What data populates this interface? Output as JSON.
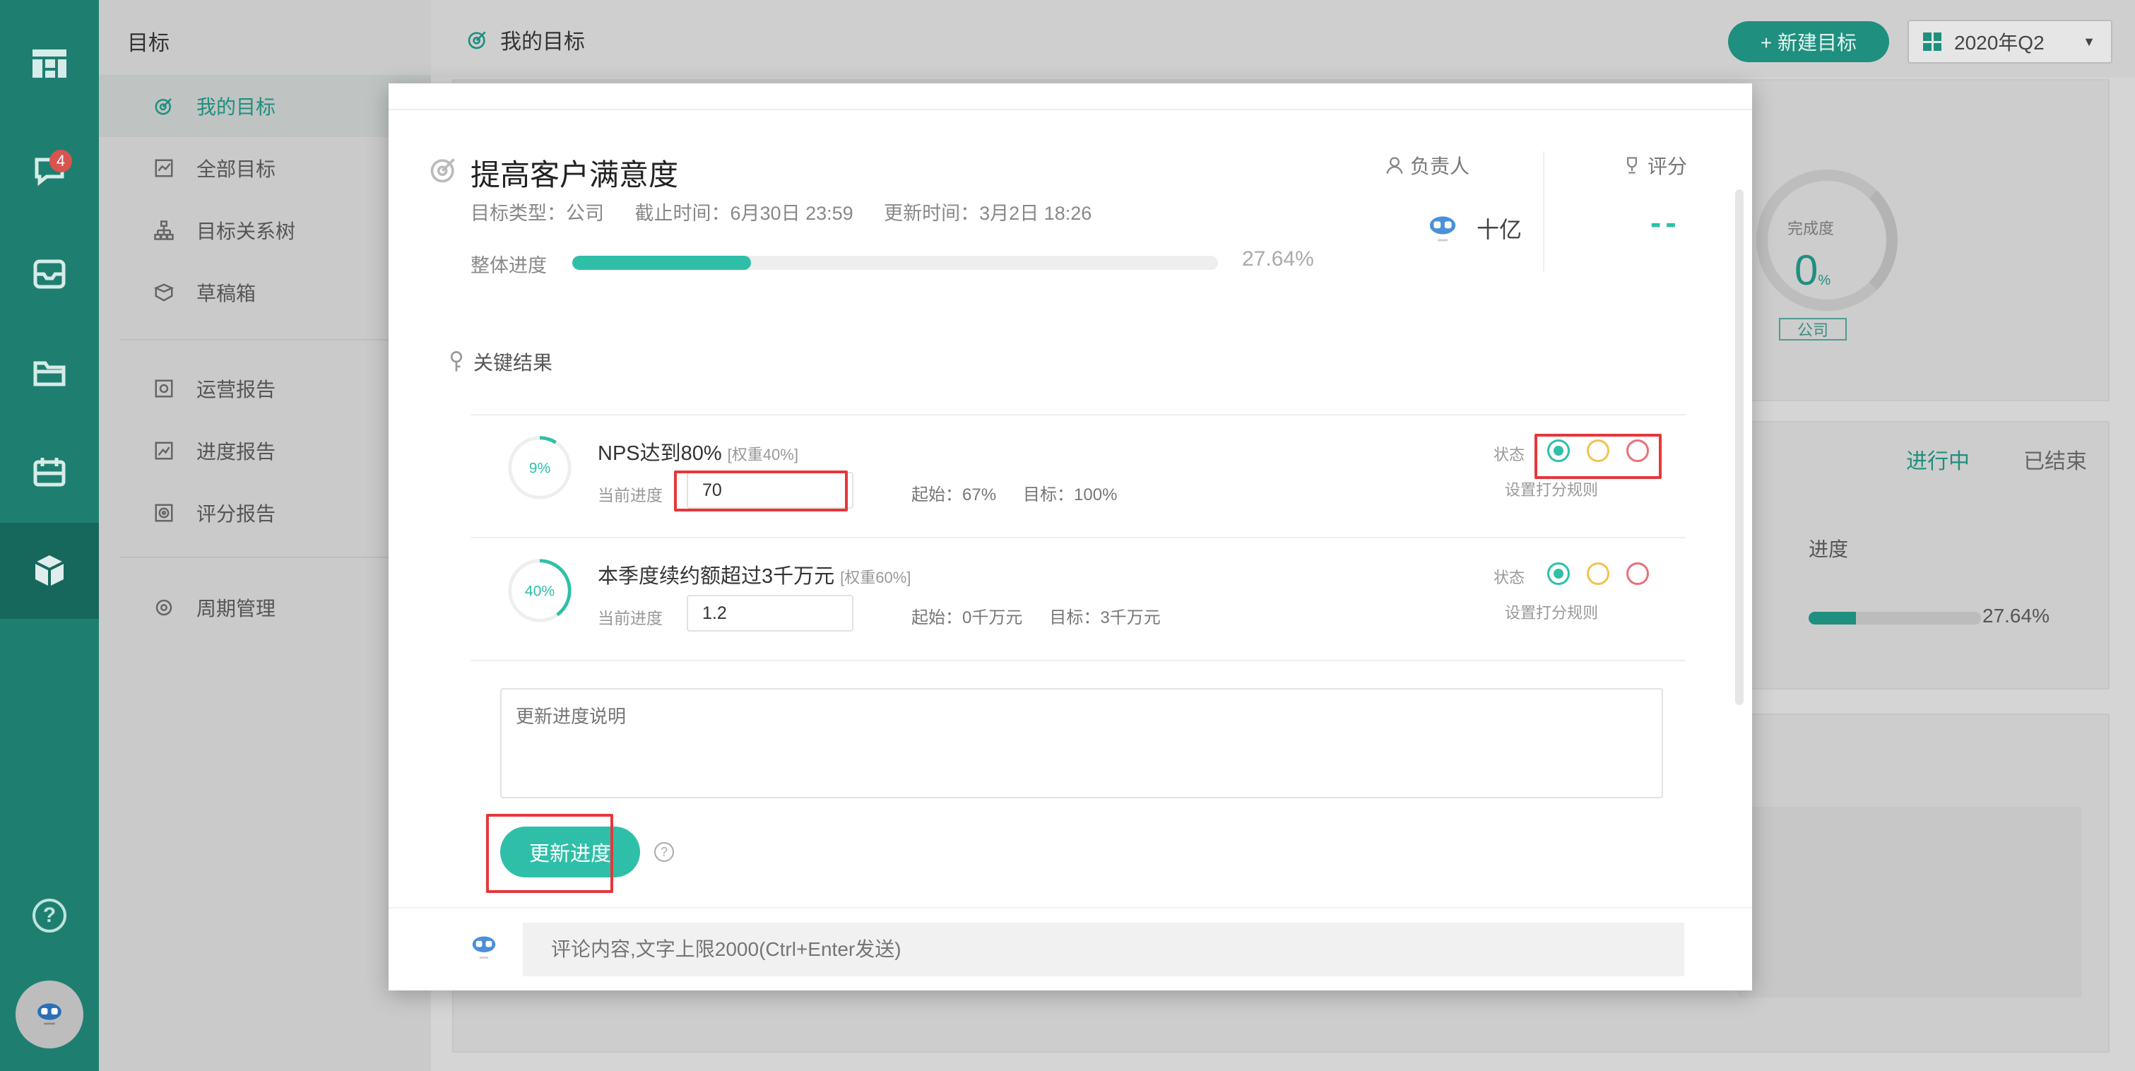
{
  "colors": {
    "accent": "#2fbfa8",
    "sidebar": "#1e7f71",
    "highlight_box": "#e5373b"
  },
  "rail": {
    "icons": [
      "dashboard-icon",
      "chat-icon",
      "inbox-icon",
      "folder-icon",
      "calendar-icon",
      "box-icon"
    ],
    "notification_count": "4",
    "help": "?"
  },
  "sidebar": {
    "title": "目标",
    "items": [
      {
        "label": "我的目标",
        "icon": "target-icon"
      },
      {
        "label": "全部目标",
        "icon": "chart-icon"
      },
      {
        "label": "目标关系树",
        "icon": "tree-icon"
      },
      {
        "label": "草稿箱",
        "icon": "box-icon"
      },
      {
        "label": "运营报告",
        "icon": "report-icon"
      },
      {
        "label": "进度报告",
        "icon": "trend-icon"
      },
      {
        "label": "评分报告",
        "icon": "score-report-icon"
      },
      {
        "label": "周期管理",
        "icon": "settings-icon"
      }
    ]
  },
  "topbar": {
    "title": "我的目标",
    "new_button": "+ 新建目标",
    "quarter": "2020年Q2"
  },
  "background": {
    "completion_label": "完成度",
    "completion_value": "0",
    "completion_unit": "%",
    "tag": "公司",
    "tab_active": "进行中",
    "tab_inactive": "已结束",
    "column_progress": "进度",
    "progress_value": "27.64%",
    "progress_fraction": 0.2764
  },
  "modal": {
    "title": "提高客户满意度",
    "meta": {
      "type": "目标类型：公司",
      "deadline": "截止时间：6月30日 23:59",
      "updated": "更新时间：3月2日 18:26"
    },
    "overall_label": "整体进度",
    "overall_value": "27.64%",
    "overall_fraction": 0.2764,
    "owner_label": "负责人",
    "owner_name": "十亿",
    "score_label": "评分",
    "score_value": "--",
    "key_results_label": "关键结果",
    "key_results": [
      {
        "percent": "9%",
        "fraction": 0.09,
        "name": "NPS达到80%",
        "weight": "[权重40%]",
        "current_label": "当前进度",
        "current_value": "70",
        "start": "起始：67%",
        "target": "目标：100%",
        "state_label": "状态",
        "rule_label": "设置打分规则"
      },
      {
        "percent": "40%",
        "fraction": 0.4,
        "name": "本季度续约额超过3千万元",
        "weight": "[权重60%]",
        "current_label": "当前进度",
        "current_value": "1.2",
        "start": "起始：0千万元",
        "target": "目标：3千万元",
        "state_label": "状态",
        "rule_label": "设置打分规则"
      }
    ],
    "description_placeholder": "更新进度说明",
    "update_button": "更新进度",
    "help": "?",
    "comment_placeholder": "评论内容,文字上限2000(Ctrl+Enter发送)"
  }
}
